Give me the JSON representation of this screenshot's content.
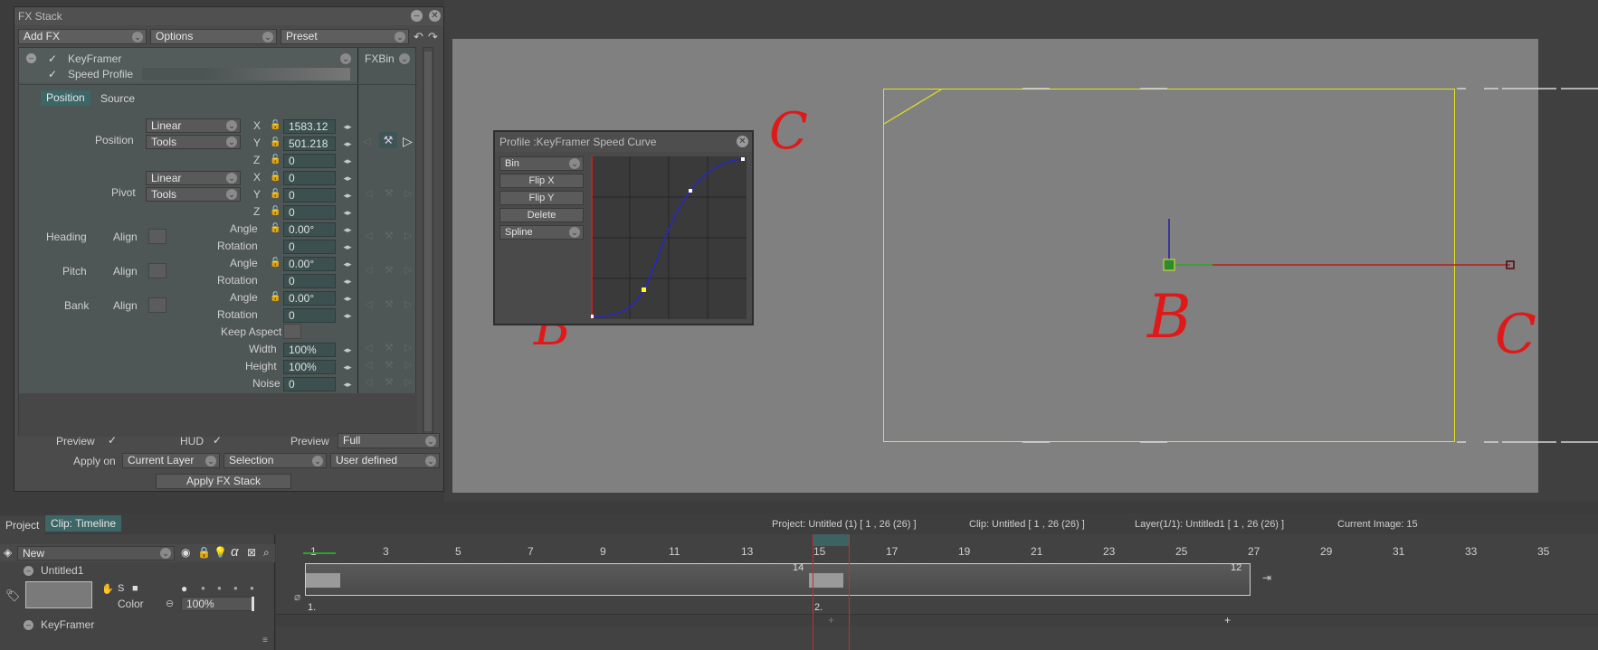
{
  "fx_stack": {
    "title": "FX Stack",
    "toolbar": {
      "add_fx": "Add FX",
      "options": "Options",
      "preset": "Preset"
    },
    "fx_item": {
      "name": "KeyFramer",
      "sub": "Speed Profile",
      "bin": "FXBin"
    },
    "tabs": {
      "position": "Position",
      "source": "Source"
    },
    "position": {
      "label": "Position",
      "interp": "Linear",
      "tools": "Tools",
      "x_label": "X",
      "x": "1583.12",
      "y_label": "Y",
      "y": "501.218",
      "z_label": "Z",
      "z": "0"
    },
    "pivot": {
      "label": "Pivot",
      "interp": "Linear",
      "tools": "Tools",
      "x_label": "X",
      "x": "0",
      "y_label": "Y",
      "y": "0",
      "z_label": "Z",
      "z": "0"
    },
    "heading": {
      "label": "Heading",
      "align": "Align",
      "angle_label": "Angle",
      "angle": "0.00°",
      "rotation_label": "Rotation",
      "rotation": "0"
    },
    "pitch": {
      "label": "Pitch",
      "align": "Align",
      "angle_label": "Angle",
      "angle": "0.00°",
      "rotation_label": "Rotation",
      "rotation": "0"
    },
    "bank": {
      "label": "Bank",
      "align": "Align",
      "angle_label": "Angle",
      "angle": "0.00°",
      "rotation_label": "Rotation",
      "rotation": "0"
    },
    "keep_aspect": "Keep Aspect",
    "width": {
      "label": "Width",
      "value": "100%"
    },
    "height": {
      "label": "Height",
      "value": "100%"
    },
    "noise": {
      "label": "Noise",
      "value": "0"
    },
    "footer": {
      "preview_label": "Preview",
      "hud_label": "HUD",
      "preview2_label": "Preview",
      "preview_quality": "Full",
      "apply_on_label": "Apply on",
      "apply_target": "Current Layer",
      "selection": "Selection",
      "user_defined": "User defined",
      "apply_button": "Apply FX Stack"
    }
  },
  "profile_popup": {
    "title": "Profile :KeyFramer Speed Curve",
    "bin": "Bin",
    "flip_x": "Flip X",
    "flip_y": "Flip Y",
    "delete": "Delete",
    "spline": "Spline"
  },
  "annotations": {
    "c_popup": "C",
    "b_popup": "B",
    "b_view": "B",
    "c_view": "C"
  },
  "timeline": {
    "tabs": {
      "project": "Project",
      "clip": "Clip: Timeline"
    },
    "status": {
      "project": "Project: Untitled (1) [ 1 , 26  (26) ]",
      "clip": "Clip: Untitled [ 1 , 26  (26) ]",
      "layer": "Layer(1/1): Untitled1 [ 1 , 26  (26) ]",
      "current": "Current Image: 15"
    },
    "tree": {
      "new_label": "New",
      "layer_name": "Untitled1",
      "color_label": "Color",
      "opacity": "100%",
      "fx_name": "KeyFramer"
    },
    "ticks": [
      "1",
      "3",
      "5",
      "7",
      "9",
      "11",
      "13",
      "15",
      "17",
      "19",
      "21",
      "23",
      "25",
      "27",
      "29",
      "31",
      "33",
      "35"
    ],
    "clip_labels": {
      "start": "1.",
      "mid": "2.",
      "mark14": "14",
      "mark12": "12"
    },
    "colors": {
      "accent": "#3d6666",
      "marker": "#c03030",
      "frame": "#e6e020"
    }
  }
}
